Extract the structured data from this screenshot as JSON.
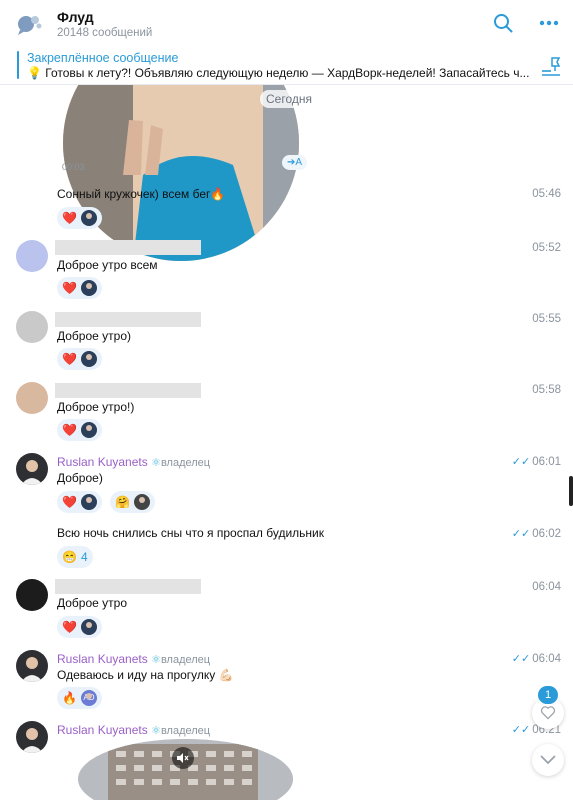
{
  "header": {
    "title": "Флуд",
    "subtitle": "20148 сообщений"
  },
  "pinned": {
    "title": "Закреплённое сообщение",
    "text": "💡 Готовы к лету?!  Объявляю следующую неделю — ХардВорк-неделей!  Запасайтесь ч..."
  },
  "video": {
    "date_label": "Сегодня",
    "duration": "00:03",
    "translate_label": "➔A"
  },
  "messages": [
    {
      "text": "Сонный кружочек) всем бег🔥",
      "time": "05:46"
    },
    {
      "text": "Доброе утро всем",
      "time": "05:52"
    },
    {
      "text": "Доброе утро)",
      "time": "05:55"
    },
    {
      "text": "Доброе утро!)",
      "time": "05:58"
    },
    {
      "author": "Ruslan Kuyanets",
      "badge": "⚛",
      "role": "владелец",
      "text": "Доброе)",
      "time": "06:01"
    },
    {
      "text": "Всю ночь снились сны что я проспал будильник",
      "time": "06:02",
      "reaction_count": "4"
    },
    {
      "text": "Доброе утро",
      "time": "06:04"
    },
    {
      "author": "Ruslan Kuyanets",
      "badge": "⚛",
      "role": "владелец",
      "text": "Одеваюсь и иду на прогулку 💪🏻",
      "time": "06:04"
    },
    {
      "author": "Ruslan Kuyanets",
      "badge": "⚛",
      "role": "владелец",
      "time": "06:21"
    }
  ],
  "reactions": {
    "heart": "❤️",
    "fire": "🔥",
    "grin": "😁",
    "hug": "🤗",
    "ad_label": "AD"
  },
  "unread_count": "1",
  "colors": {
    "accent": "#2a9bd8",
    "owner_name": "#9a5fc7",
    "reaction_bg": "#e9f2fa"
  }
}
